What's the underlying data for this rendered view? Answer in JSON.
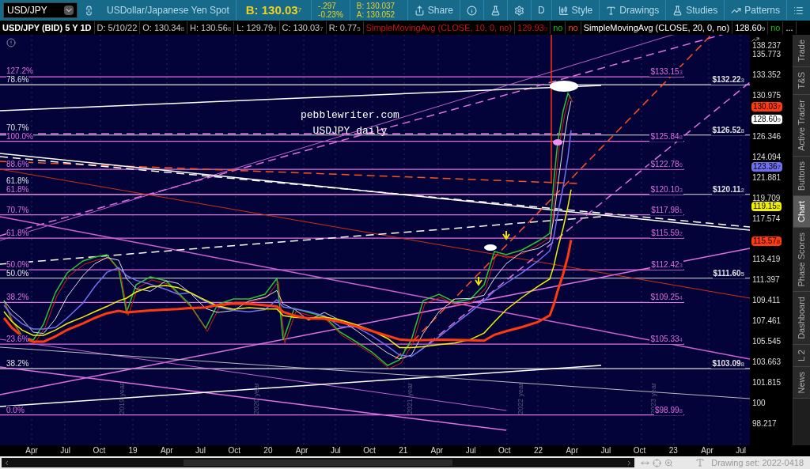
{
  "toolbar": {
    "symbol": "USD/JPY",
    "description": "USDollar/Japanese Yen Spot",
    "bid": {
      "main": "B: 130.03",
      "digit": "7"
    },
    "change": "-.297",
    "change_pct": "-0.23%",
    "bid_small": "B: 130.037",
    "ask_small": "A: 130.052",
    "buttons": [
      {
        "kind": "share",
        "label": "Share"
      },
      {
        "kind": "info"
      },
      {
        "kind": "flask"
      },
      {
        "kind": "gear"
      },
      {
        "kind": "text",
        "label": "D"
      },
      {
        "kind": "style",
        "label": "Style"
      },
      {
        "kind": "drawings",
        "label": "Drawings"
      },
      {
        "kind": "studies",
        "label": "Studies"
      },
      {
        "kind": "patterns",
        "label": "Patterns"
      },
      {
        "kind": "menu"
      }
    ]
  },
  "info_bar": [
    {
      "text": "USD/JPY (BID) 5 Y 1D",
      "kind": "title"
    },
    {
      "text": "D: 5/10/22",
      "kind": "plain"
    },
    {
      "text": "O: 130.34",
      "digit": "8",
      "kind": "plain"
    },
    {
      "text": "H: 130.56",
      "digit": "8",
      "kind": "plain"
    },
    {
      "text": "L: 129.79",
      "digit": "3",
      "kind": "plain"
    },
    {
      "text": "C: 130.03",
      "digit": "7",
      "kind": "plain"
    },
    {
      "text": "R: 0.77",
      "digit": "5",
      "kind": "plain"
    },
    {
      "text": "SimpleMovingAvg (CLOSE, 10, 0, no)",
      "kind": "alert"
    },
    {
      "text": "129.93",
      "digit": "9",
      "kind": "alert"
    },
    {
      "text": "no",
      "kind": "ok"
    },
    {
      "text": "no",
      "kind": "warn"
    },
    {
      "text": "SimpleMovingAvg (CLOSE, 20, 0, no)",
      "kind": "study"
    },
    {
      "text": "128.60",
      "digit": "9",
      "kind": "study"
    },
    {
      "text": "no",
      "kind": "ok"
    },
    {
      "text": "...",
      "kind": "study"
    }
  ],
  "chart": {
    "watermark": [
      "pebblewriter.com",
      "USDJPY daily"
    ],
    "levels": [
      {
        "price": "$133.15",
        "digit": "3",
        "fib": "127.2%",
        "color": "#e070e0"
      },
      {
        "price": "$132.22",
        "digit": "3",
        "fib": "78.6%",
        "color": "#e0e0e0"
      },
      {
        "price": "$126.52",
        "digit": "8",
        "fib": "70.7%",
        "color": "#e0e0e0"
      },
      {
        "price": "$125.84",
        "digit": "8",
        "fib": "100.0%",
        "color": "#e070e0"
      },
      {
        "price": "$122.78",
        "digit": "6",
        "fib": "88.6%",
        "color": "#e070e0"
      },
      {
        "price": "$120.11",
        "digit": "2",
        "fib": "61.8%",
        "color": "#e0e0e0"
      },
      {
        "price": "$120.10",
        "digit": "3",
        "fib": "61.8%",
        "color": "#e070e0"
      },
      {
        "price": "$117.98",
        "digit": "1",
        "fib": "70.7%",
        "color": "#e070e0"
      },
      {
        "price": "$115.59",
        "digit": "2",
        "fib": "61.8%",
        "color": "#e070e0"
      },
      {
        "price": "$112.42",
        "digit": "3",
        "fib": "50.0%",
        "color": "#e070e0"
      },
      {
        "price": "$111.60",
        "digit": "5",
        "fib": "50.0%",
        "color": "#e0e0e0"
      },
      {
        "price": "$109.25",
        "digit": "4",
        "fib": "38.2%",
        "color": "#e070e0"
      },
      {
        "price": "$105.33",
        "digit": "4",
        "fib": "23.6%",
        "color": "#e070e0"
      },
      {
        "price": "$103.09",
        "digit": "8",
        "fib": "38.2%",
        "color": "#e0e0e0"
      },
      {
        "price": "$98.99",
        "digit": "8",
        "fib": "0.0%",
        "color": "#e070e0"
      }
    ],
    "year_markers": [
      "2019 year",
      "2020 year",
      "2021 year",
      "2022 year",
      "2023 year"
    ]
  },
  "price_axis": {
    "ticks": [
      "138.237",
      "135.773",
      "133.352",
      "130.975",
      "126.346",
      "124.094",
      "121.881",
      "119.709",
      "117.574",
      "113.419",
      "111.397",
      "109.411",
      "107.461",
      "105.545",
      "103.663",
      "101.815",
      "100",
      "98.217"
    ],
    "badges": [
      {
        "value": "130.03",
        "digit": "7",
        "color": "#ff3a10"
      },
      {
        "value": "128.60",
        "digit": "9",
        "color": "#ffffff"
      },
      {
        "value": "123.36",
        "digit": "7",
        "color": "#6e6ef0"
      },
      {
        "value": "119.15",
        "digit": "2",
        "color": "#f0f000"
      },
      {
        "value": "115.57",
        "digit": "8",
        "color": "#ff3a10"
      }
    ]
  },
  "time_axis": [
    "Apr",
    "Jul",
    "Oct",
    "19",
    "Apr",
    "Jul",
    "Oct",
    "20",
    "Apr",
    "Jul",
    "Oct",
    "21",
    "Apr",
    "Jul",
    "Oct",
    "22",
    "Apr",
    "Jul",
    "Oct",
    "23",
    "Apr",
    "Jul"
  ],
  "side_tabs": [
    {
      "label": "Trade",
      "selected": false
    },
    {
      "label": "T&S",
      "selected": false
    },
    {
      "label": "Active Trader",
      "selected": false
    },
    {
      "label": "Buttons",
      "selected": false
    },
    {
      "label": "Chart",
      "selected": true
    },
    {
      "label": "Phase Scores",
      "selected": false
    },
    {
      "label": "Dashboard",
      "selected": false
    },
    {
      "label": "L 2",
      "selected": false
    },
    {
      "label": "News",
      "selected": false
    }
  ],
  "status": {
    "drawing_set": "Drawing set: 2022-0418"
  }
}
